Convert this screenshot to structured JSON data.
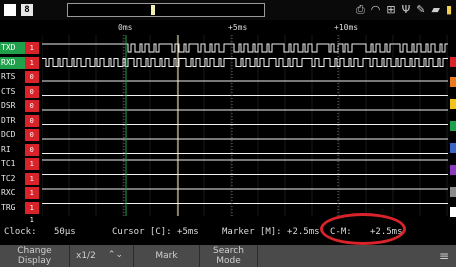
{
  "top": {
    "channel_label": "8",
    "status_icons": [
      "printer-icon",
      "wifi-icon",
      "network-icon",
      "usb-icon",
      "pen-icon",
      "sd-card-icon",
      "battery-icon"
    ]
  },
  "ruler": {
    "t0": "0ms",
    "t1": "+5ms",
    "t2": "+10ms"
  },
  "channels": [
    {
      "label": "TXD",
      "bits": "1 1"
    },
    {
      "label": "RXD",
      "bits": "1 1"
    },
    {
      "label": "RTS",
      "bits": "0 0"
    },
    {
      "label": "CTS",
      "bits": "0 0"
    },
    {
      "label": "DSR",
      "bits": "0 0"
    },
    {
      "label": "DTR",
      "bits": "0 0"
    },
    {
      "label": "DCD",
      "bits": "0 0"
    },
    {
      "label": "RI",
      "bits": "0 0"
    },
    {
      "label": "TC1",
      "bits": "1 1"
    },
    {
      "label": "TC2",
      "bits": "1 1"
    },
    {
      "label": "RXC",
      "bits": "1 1"
    },
    {
      "label": "TRG",
      "bits": "1 1"
    }
  ],
  "info": {
    "clock_label": "Clock:",
    "clock_value": "50µs",
    "cursor": "Cursor [C]: +5ms",
    "marker": "Marker [M]: +2.5ms",
    "cm_label": "C-M:",
    "cm_value": "+2.5ms"
  },
  "menu": {
    "change_display": "Change Display",
    "zoom": "x1/2",
    "mark": "Mark",
    "search_mode": "Search Mode",
    "menu_icon": "menu-lines-icon"
  },
  "colors": {
    "accent_red": "#d8232a",
    "label_green": "#1fa04a",
    "cursor_line": "#1fa04a",
    "marker_line": "#f3f1b0"
  }
}
